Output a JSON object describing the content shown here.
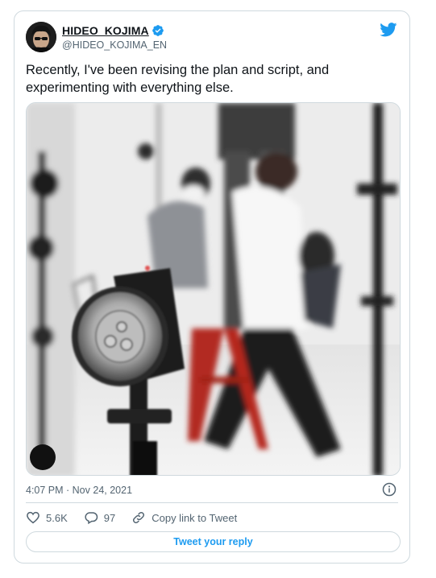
{
  "author": {
    "name": "HIDEO_KOJIMA",
    "handle": "@HIDEO_KOJIMA_EN"
  },
  "icons": {
    "verified": "verified-badge-icon",
    "platform": "twitter-bird-icon",
    "info": "info-icon",
    "like": "heart-icon",
    "reply": "speech-bubble-icon",
    "copy_link": "link-icon"
  },
  "tweet": {
    "text": "Recently, I've been revising the plan and script, and experimenting with everything else.",
    "timestamp": "4:07 PM · Nov 24, 2021"
  },
  "stats": {
    "likes": "5.6K",
    "replies": "97",
    "copy_link_label": "Copy link to Tweet"
  },
  "reply_button": {
    "label": "Tweet your reply"
  },
  "colors": {
    "accent": "#1d9bf0",
    "secondary_text": "#536471",
    "border": "#cfd9de"
  }
}
